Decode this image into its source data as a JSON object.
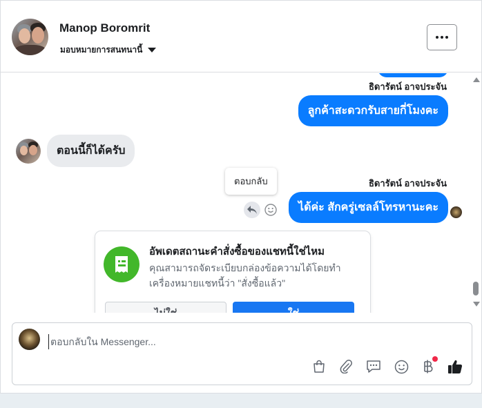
{
  "header": {
    "contact_name": "Manop Boromrit",
    "assign_label": "มอบหมายการสนทนานี้",
    "more_label": "•••"
  },
  "messages": [
    {
      "direction": "out",
      "sender": "ธิดารัตน์ อาจประจัน",
      "text": "ลูกค้าสะดวกรับสายกี่โมงคะ"
    },
    {
      "direction": "in",
      "sender": "Manop Boromrit",
      "text": "ตอนนี้ก็ได้ครับ"
    },
    {
      "direction": "out",
      "sender": "ธิดารัตน์ อาจประจัน",
      "text": "ได้ค่ะ สักครู่เซลล์โทรหานะคะ"
    }
  ],
  "tooltip": {
    "reply": "ตอบกลับ"
  },
  "card": {
    "title": "อัพเดตสถานะคำสั่งซื้อของแชทนี้ใช่ไหม",
    "description": "คุณสามารถจัดระเบียบกล่องข้อความได้โดยทำเครื่องหมายแชทนี้ว่า \"สั่งซื้อแล้ว\"",
    "no_label": "ไม่ใช่",
    "yes_label": "ใช่"
  },
  "composer": {
    "placeholder": "ตอบกลับใน Messenger..."
  },
  "toolbar": {
    "icons": [
      "shopping-bag-icon",
      "attachment-icon",
      "saved-reply-icon",
      "emoji-icon",
      "baht-payment-icon",
      "thumbs-up-icon"
    ]
  },
  "colors": {
    "outgoing_bubble": "#0a7cff",
    "incoming_bubble": "#e9ebee",
    "card_icon": "#42b72a",
    "primary_button": "#1877f2",
    "notification_dot": "#f02849"
  }
}
